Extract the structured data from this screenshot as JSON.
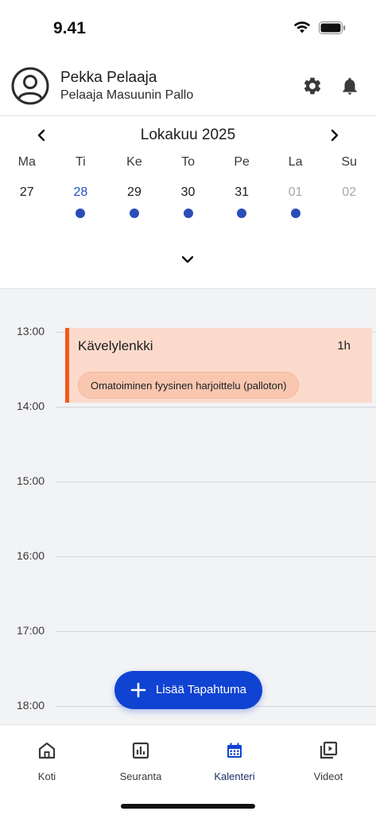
{
  "status_bar": {
    "time": "9.41"
  },
  "profile": {
    "name": "Pekka Pelaaja",
    "subtitle": "Pelaaja Masuunin Pallo"
  },
  "calendar": {
    "month_label": "Lokakuu 2025",
    "weekdays": [
      "Ma",
      "Ti",
      "Ke",
      "To",
      "Pe",
      "La",
      "Su"
    ],
    "dates": [
      {
        "day": "27",
        "state": "normal",
        "has_event": false
      },
      {
        "day": "28",
        "state": "selected",
        "has_event": true
      },
      {
        "day": "29",
        "state": "normal",
        "has_event": true
      },
      {
        "day": "30",
        "state": "normal",
        "has_event": true
      },
      {
        "day": "31",
        "state": "normal",
        "has_event": true
      },
      {
        "day": "01",
        "state": "muted",
        "has_event": true
      },
      {
        "day": "02",
        "state": "muted",
        "has_event": false
      }
    ]
  },
  "timeline": {
    "hours": [
      "13:00",
      "14:00",
      "15:00",
      "16:00",
      "17:00",
      "18:00"
    ],
    "event": {
      "title": "Kävelylenkki",
      "duration": "1h",
      "tag": "Omatoiminen fyysinen harjoittelu (palloton)",
      "accent_color": "#f25a1b",
      "background_color": "#fcdacb"
    }
  },
  "fab": {
    "label": "Lisää Tapahtuma",
    "icon": "plus-icon",
    "color": "#1043d2"
  },
  "bottom_nav": {
    "active_index": 2,
    "items": [
      {
        "label": "Koti",
        "icon": "home-icon"
      },
      {
        "label": "Seuranta",
        "icon": "bar-chart-icon"
      },
      {
        "label": "Kalenteri",
        "icon": "calendar-icon"
      },
      {
        "label": "Videot",
        "icon": "video-library-icon"
      }
    ]
  },
  "colors": {
    "accent": "#1043d2",
    "event_dot": "#2b4db8",
    "selected_date": "#1f4fbf"
  }
}
